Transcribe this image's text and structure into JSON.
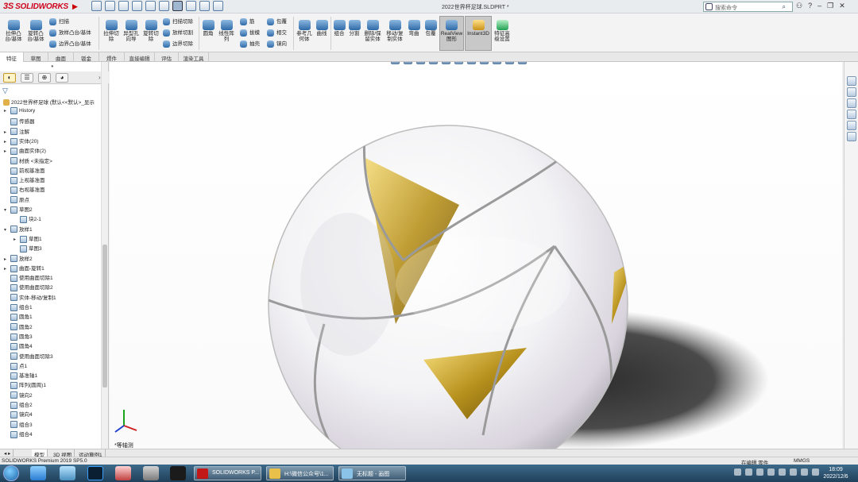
{
  "app": {
    "logo_text": "SOLIDWORKS",
    "doc_title": "2022世界杯足球.SLDPRT *",
    "search_placeholder": "搜索命令",
    "help_label": "?"
  },
  "ribbon": {
    "extrude_boss": "拉伸凸\n台/基体",
    "revolve_boss": "旋转凸\n台/基体",
    "sweep": "扫描",
    "loft": "放样凸台/基体",
    "boundary_boss": "边界凸台/基体",
    "extrude_cut": "拉伸切\n除",
    "hole_wizard": "异型孔\n向导",
    "revolve_cut": "旋转切\n除",
    "swept_cut": "扫描切除",
    "lofted_cut": "放样切割",
    "boundary_cut": "边界切除",
    "fillet": "圆角",
    "linear_pattern": "线性阵\n列",
    "rib": "筋",
    "draft": "拔模",
    "shell": "抽壳",
    "wrap": "包覆",
    "intersect": "相交",
    "mirror": "镜向",
    "ref_geometry": "参考几\n何体",
    "curves": "曲线",
    "combine": "组合",
    "split": "分割",
    "delete_body": "删除/保\n留实体",
    "move_copy": "移动/复\n制实体",
    "dome": "弯曲",
    "wrap2": "包覆",
    "realview": "RealView\n图形",
    "instant3d": "Instant3D",
    "adv_feature": "特征高\n级设置"
  },
  "cmd_tabs": [
    "特征",
    "草图",
    "曲面",
    "钣金",
    "焊件",
    "直接编辑",
    "评估",
    "渲染工具"
  ],
  "feature_tree": {
    "root": "2022世界杯足球 (默认<<默认>_显示",
    "nodes": [
      {
        "label": "History",
        "exp": "▸",
        "indent": 0
      },
      {
        "label": "传感器",
        "exp": "",
        "indent": 0
      },
      {
        "label": "注解",
        "exp": "▸",
        "indent": 0
      },
      {
        "label": "实体(20)",
        "exp": "▸",
        "indent": 0
      },
      {
        "label": "曲面实体(2)",
        "exp": "▸",
        "indent": 0
      },
      {
        "label": "材质 <未指定>",
        "exp": "",
        "indent": 0
      },
      {
        "label": "前视基准面",
        "exp": "",
        "indent": 0
      },
      {
        "label": "上视基准面",
        "exp": "",
        "indent": 0
      },
      {
        "label": "右视基准面",
        "exp": "",
        "indent": 0
      },
      {
        "label": "原点",
        "exp": "",
        "indent": 0
      },
      {
        "label": "草图2",
        "exp": "▾",
        "indent": 0
      },
      {
        "label": "块2-1",
        "exp": "",
        "indent": 1
      },
      {
        "label": "放样1",
        "exp": "▾",
        "indent": 0
      },
      {
        "label": "草图1",
        "exp": "▸",
        "indent": 1
      },
      {
        "label": "草图3",
        "exp": "",
        "indent": 1
      },
      {
        "label": "放样2",
        "exp": "▸",
        "indent": 0
      },
      {
        "label": "曲面-旋转1",
        "exp": "▸",
        "indent": 0
      },
      {
        "label": "使用曲面切除1",
        "exp": "",
        "indent": 0
      },
      {
        "label": "使用曲面切除2",
        "exp": "",
        "indent": 0
      },
      {
        "label": "实体-移动/复制1",
        "exp": "",
        "indent": 0
      },
      {
        "label": "组合1",
        "exp": "",
        "indent": 0
      },
      {
        "label": "圆角1",
        "exp": "",
        "indent": 0
      },
      {
        "label": "圆角2",
        "exp": "",
        "indent": 0
      },
      {
        "label": "圆角3",
        "exp": "",
        "indent": 0
      },
      {
        "label": "圆角4",
        "exp": "",
        "indent": 0
      },
      {
        "label": "使用曲面切除3",
        "exp": "",
        "indent": 0
      },
      {
        "label": "点1",
        "exp": "",
        "indent": 0
      },
      {
        "label": "基准轴1",
        "exp": "",
        "indent": 0
      },
      {
        "label": "阵列(圆周)1",
        "exp": "",
        "indent": 0
      },
      {
        "label": "镜向2",
        "exp": "",
        "indent": 0
      },
      {
        "label": "组合2",
        "exp": "",
        "indent": 0
      },
      {
        "label": "镜向4",
        "exp": "",
        "indent": 0
      },
      {
        "label": "组合3",
        "exp": "",
        "indent": 0
      },
      {
        "label": "组合4",
        "exp": "",
        "indent": 0
      }
    ]
  },
  "viewport": {
    "view_label": "*等轴测",
    "colors": {
      "body": "#ececec",
      "accent_gold": "#b8921e",
      "seam": "#9a9a9a"
    }
  },
  "model_tabs": [
    "模型",
    "3D 视图",
    "运动算例1"
  ],
  "status": {
    "left": "SOLIDWORKS Premium 2019 SP5.0",
    "mode": "在编辑 零件",
    "units": "MMGS"
  },
  "taskbar": {
    "windows": [
      "SOLIDWORKS P...",
      "H:\\微信公众号\\1...",
      "无标题 - 画图"
    ],
    "time": "18:09",
    "date": "2022/12/6"
  }
}
